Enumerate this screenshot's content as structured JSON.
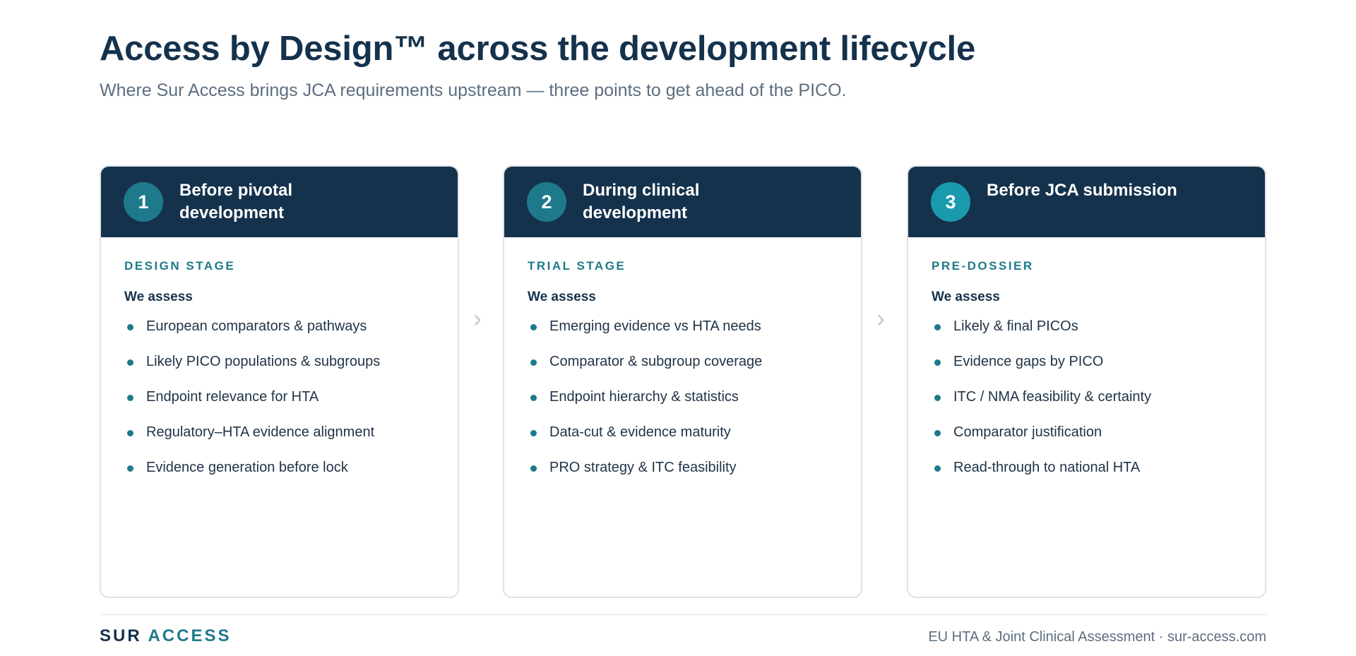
{
  "header": {
    "title": "Access by Design™ across the development lifecycle",
    "subtitle": "Where Sur Access brings JCA requirements upstream — three points to get ahead of the PICO."
  },
  "colors": {
    "navy": "#15324d",
    "teal": "#1e7a8a",
    "teal_bright": "#1a9aad",
    "muted": "#5d6e80"
  },
  "stages": [
    {
      "number": "1",
      "title": "Before pivotal development",
      "stage_label": "DESIGN STAGE",
      "assess_label": "We assess",
      "items": [
        "European comparators & pathways",
        "Likely PICO populations & subgroups",
        "Endpoint relevance for HTA",
        "Regulatory–HTA evidence alignment",
        "Evidence generation before lock"
      ]
    },
    {
      "number": "2",
      "title": "During clinical development",
      "stage_label": "TRIAL STAGE",
      "assess_label": "We assess",
      "items": [
        "Emerging evidence vs HTA needs",
        "Comparator & subgroup coverage",
        "Endpoint hierarchy & statistics",
        "Data-cut & evidence maturity",
        "PRO strategy & ITC feasibility"
      ]
    },
    {
      "number": "3",
      "title": "Before JCA submission",
      "stage_label": "PRE-DOSSIER",
      "assess_label": "We assess",
      "items": [
        "Likely & final PICOs",
        "Evidence gaps by PICO",
        "ITC / NMA feasibility & certainty",
        "Comparator justification",
        "Read-through to national HTA"
      ]
    }
  ],
  "arrow_glyph": "›",
  "footer": {
    "brand_first": "SUR",
    "brand_second": "ACCESS",
    "note": "EU HTA & Joint Clinical Assessment · sur-access.com"
  }
}
